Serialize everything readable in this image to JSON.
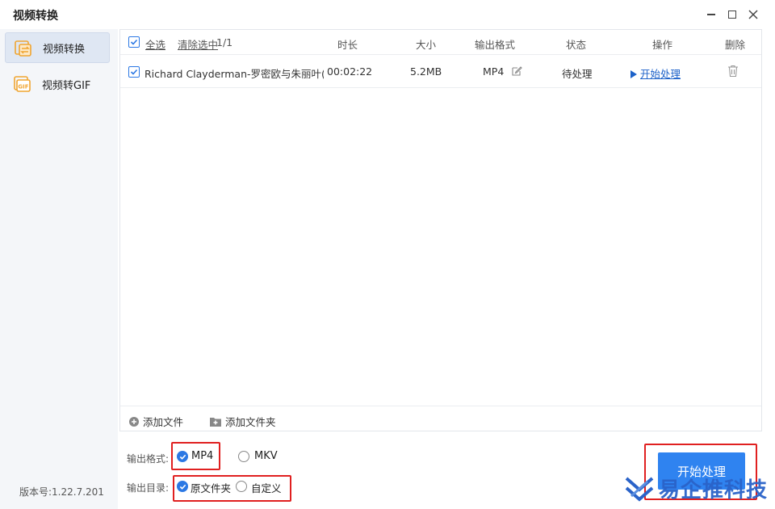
{
  "window": {
    "title": "视频转换"
  },
  "sidebar": {
    "items": [
      {
        "label": "视频转换",
        "icon": "video-convert-icon",
        "active": true
      },
      {
        "label": "视频转GIF",
        "icon": "gif-icon",
        "active": false
      }
    ],
    "version": "版本号:1.22.7.201"
  },
  "table": {
    "select_all": "全选",
    "clear_selected": "清除选中",
    "count": "1/1",
    "columns": {
      "duration": "时长",
      "size": "大小",
      "format": "输出格式",
      "status": "状态",
      "action": "操作",
      "delete": "删除"
    },
    "rows": [
      {
        "name": "Richard Clayderman-罗密欧与朱丽叶(...",
        "duration": "00:02:22",
        "size": "5.2MB",
        "format": "MP4",
        "status": "待处理",
        "action": "开始处理"
      }
    ]
  },
  "footer": {
    "add_file": "添加文件",
    "add_folder": "添加文件夹"
  },
  "settings": {
    "format_label": "输出格式:",
    "format_options": [
      "MP4",
      "MKV"
    ],
    "dir_label": "输出目录:",
    "dir_options": [
      "原文件夹",
      "自定义"
    ]
  },
  "start_button": "开始处理",
  "watermark": "易企推科技",
  "colors": {
    "accent": "#2f83f0",
    "link": "#1d62c9",
    "highlight": "#e02020"
  }
}
